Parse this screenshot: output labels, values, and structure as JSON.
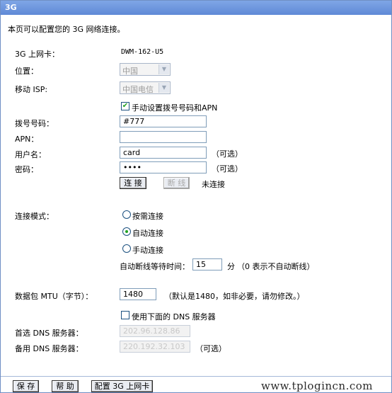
{
  "window": {
    "title": "3G"
  },
  "intro": "本页可以配置您的 3G 网络连接。",
  "card": {
    "label": "3G 上网卡：",
    "value": "DWM-162-U5"
  },
  "location": {
    "label": "位置：",
    "value": "中国"
  },
  "isp": {
    "label": "移动 ISP:",
    "value": "中国电信"
  },
  "manual_dial": {
    "label": "手动设置拨号号码和APN",
    "checked": true
  },
  "dial": {
    "label": "拨号号码：",
    "value": "#777"
  },
  "apn": {
    "label": "APN：",
    "value": ""
  },
  "username": {
    "label": "用户名：",
    "value": "card",
    "hint": "（可选）"
  },
  "password": {
    "label": "密码：",
    "value": "card",
    "hint": "（可选）"
  },
  "conn_buttons": {
    "connect": "连 接",
    "disconnect": "断 线",
    "status": "未连接"
  },
  "mode": {
    "label": "连接模式：",
    "options": [
      "按需连接",
      "自动连接",
      "手动连接"
    ],
    "selected": 1
  },
  "idle": {
    "label": "自动断线等待时间：",
    "value": "15",
    "unit": "分",
    "note": "（0 表示不自动断线）"
  },
  "mtu": {
    "label": "数据包 MTU（字节）：",
    "value": "1480",
    "note": "（默认是1480，如非必要，请勿修改。）"
  },
  "use_dns": {
    "label": "使用下面的 DNS 服务器",
    "checked": false
  },
  "dns1": {
    "label": "首选 DNS 服务器：",
    "value": "202.96.128.86"
  },
  "dns2": {
    "label": "备用 DNS 服务器：",
    "value": "220.192.32.103",
    "hint": "（可选）"
  },
  "footer": {
    "save": "保 存",
    "help": "帮 助",
    "config": "配置 3G 上网卡"
  },
  "watermark": "www.tplogincn.com",
  "colors": {
    "titlebar": "#6a93db",
    "check_green": "#21a121",
    "border": "#7f9db9"
  }
}
